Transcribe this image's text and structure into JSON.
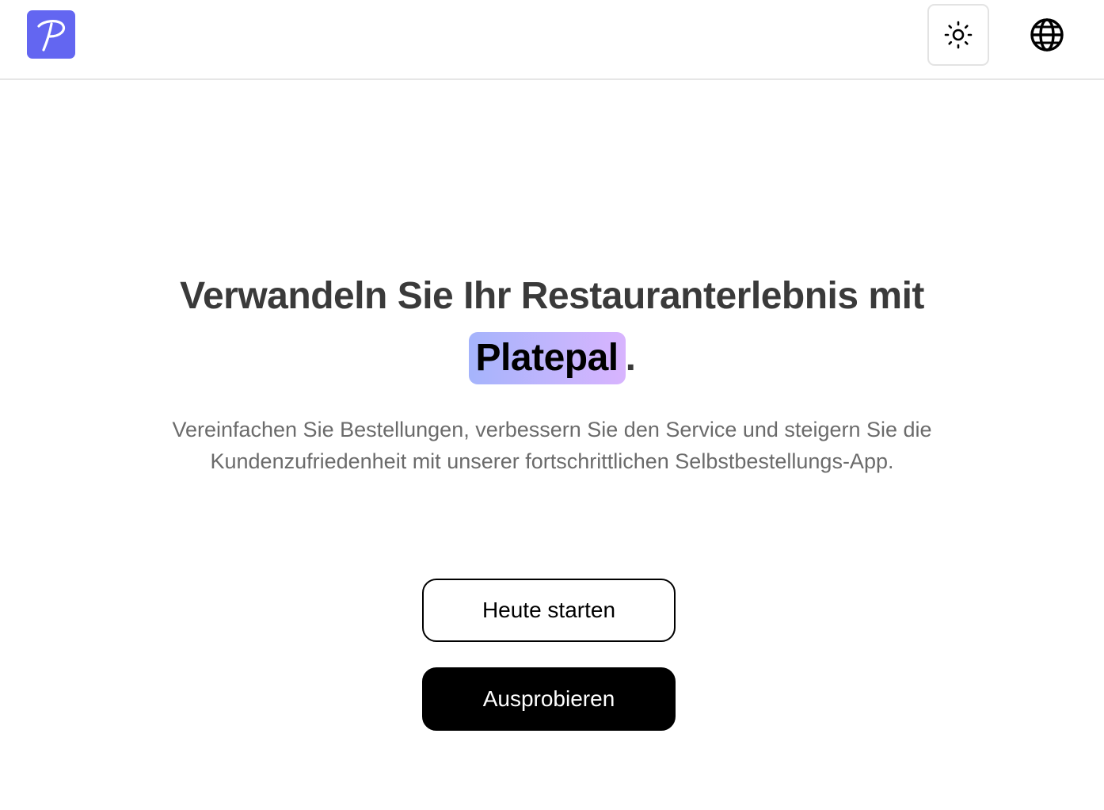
{
  "header": {
    "logo_letter": "P",
    "logo_color": "#6366f1",
    "theme_toggle_icon": "sun-icon",
    "language_icon": "globe-icon"
  },
  "hero": {
    "headline_text": "Verwandeln Sie Ihr Restauranterlebnis mit",
    "brand_name": "Platepal",
    "headline_suffix": ".",
    "subtitle": "Vereinfachen Sie Bestellungen, verbessern Sie den Service und steigern Sie die Kundenzufriedenheit mit unserer fortschrittlichen Selbstbestellungs-App."
  },
  "actions": {
    "start_label": "Heute starten",
    "try_label": "Ausprobieren"
  }
}
